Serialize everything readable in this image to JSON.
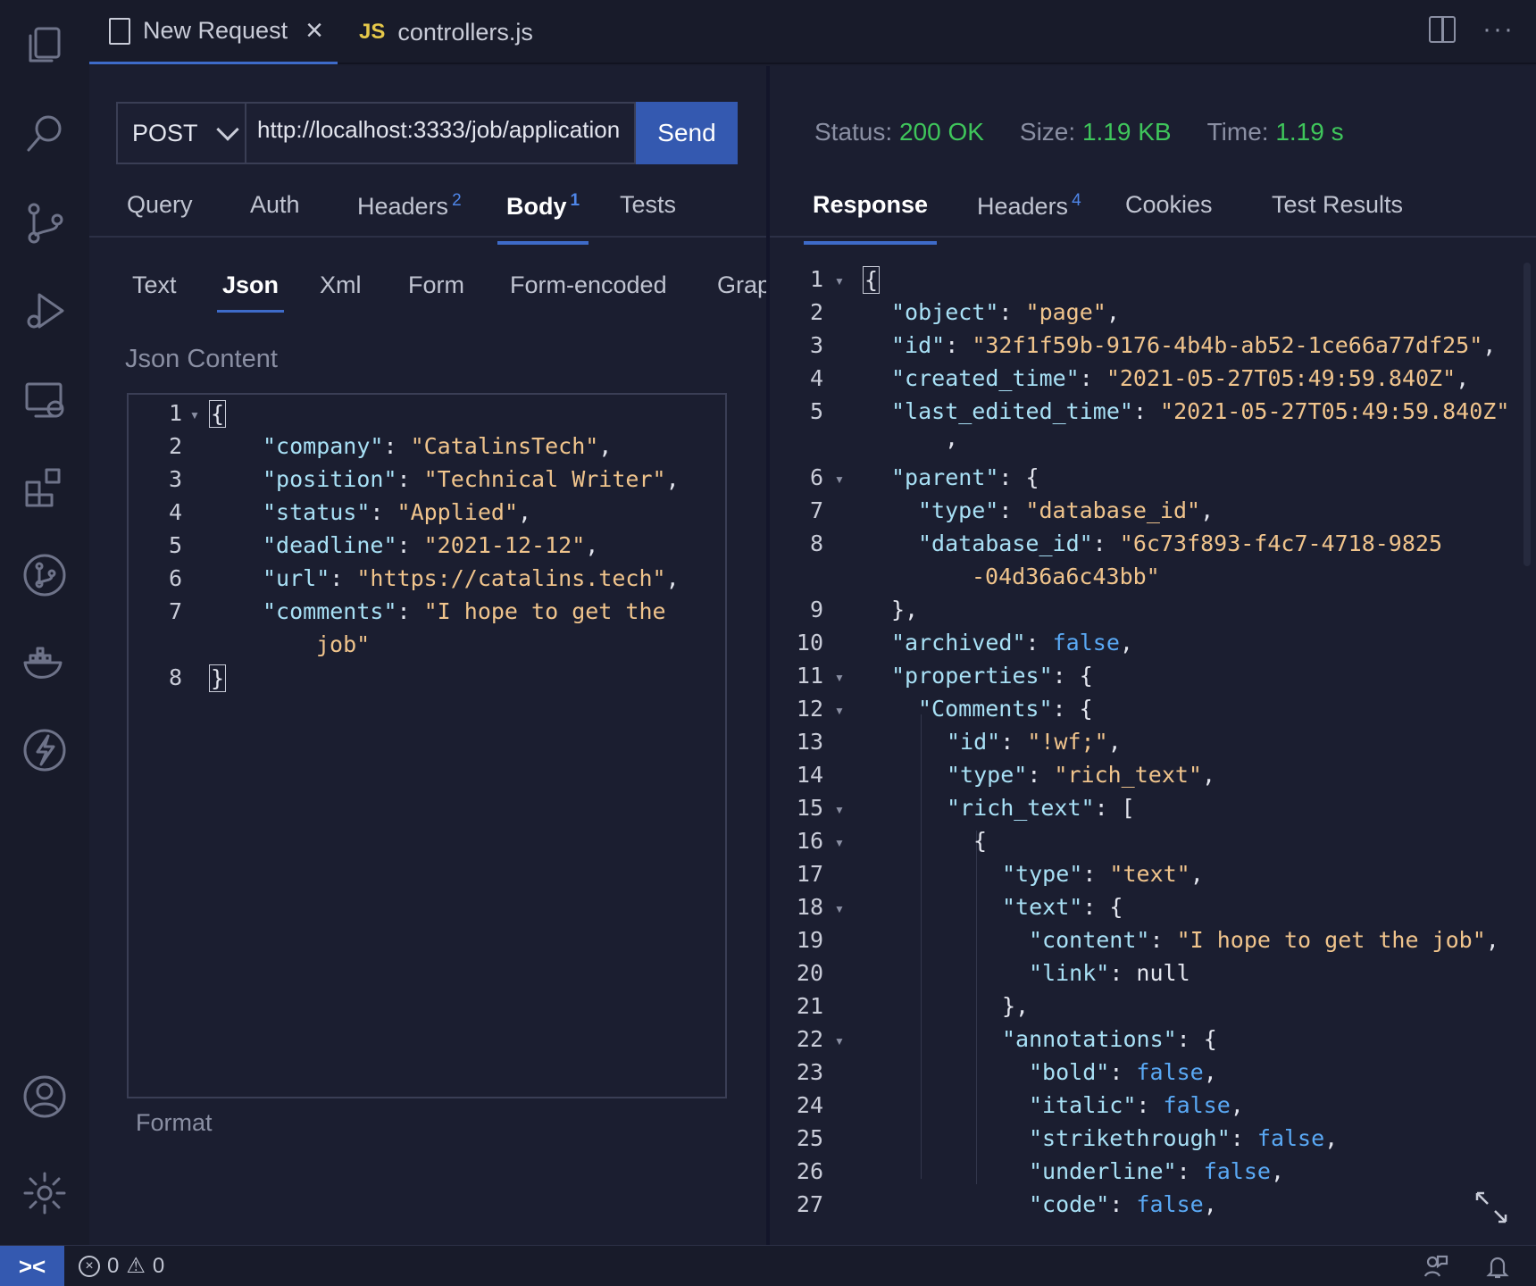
{
  "tabs": [
    {
      "label": "New Request",
      "icon": "file-icon",
      "active": true
    },
    {
      "label": "controllers.js",
      "icon": "js-icon",
      "badge": "JS",
      "active": false
    }
  ],
  "request": {
    "method": "POST",
    "url": "http://localhost:3333/job/application",
    "send_label": "Send"
  },
  "request_tabs": [
    {
      "label": "Query"
    },
    {
      "label": "Auth"
    },
    {
      "label": "Headers",
      "badge": "2"
    },
    {
      "label": "Body",
      "badge": "1",
      "active": true
    },
    {
      "label": "Tests"
    }
  ],
  "body_tabs": [
    "Text",
    "Json",
    "Xml",
    "Form",
    "Form-encoded",
    "Graphql"
  ],
  "body_active": "Json",
  "json_label": "Json Content",
  "format_label": "Format",
  "response": {
    "status_label": "Status:",
    "status_value": "200 OK",
    "size_label": "Size:",
    "size_value": "1.19 KB",
    "time_label": "Time:",
    "time_value": "1.19 s",
    "colors": {
      "success": "#3fc65b"
    }
  },
  "response_tabs": [
    {
      "label": "Response",
      "active": true
    },
    {
      "label": "Headers",
      "badge": "4"
    },
    {
      "label": "Cookies"
    },
    {
      "label": "Test Results"
    }
  ],
  "statusbar": {
    "errors": "0",
    "warnings": "0"
  }
}
